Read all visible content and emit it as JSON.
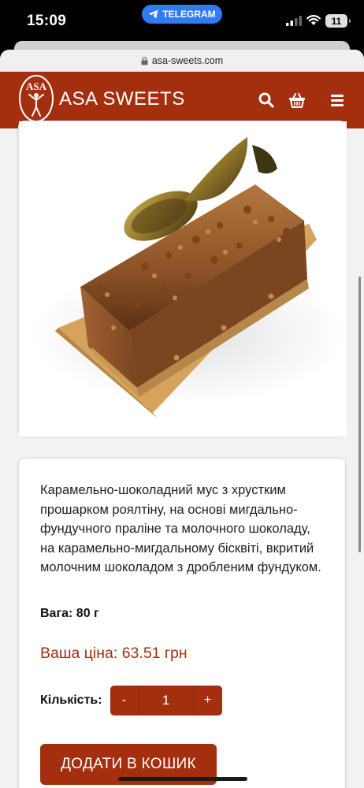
{
  "status_bar": {
    "time": "15:09",
    "app_pill": "TELEGRAM",
    "battery": "11"
  },
  "browser": {
    "url": "asa-sweets.com"
  },
  "header": {
    "logo_text": "ASA",
    "brand": "ASA SWEETS",
    "icons": [
      "search-icon",
      "basket-icon",
      "menu-icon"
    ],
    "color": "#a42f0f"
  },
  "product": {
    "description": "Карамельно-шоколадний мус з хрустким прошарком роялтіну, на основі мигдально-фундучного праліне та молочного шоколаду, на карамельно-мигдальному бісквіті, вкритий молочним шоколадом з дробленим фундуком.",
    "weight": "Вага: 80 г",
    "price": "Ваша ціна: 63.51 грн",
    "quantity_label": "Кількість:",
    "qty_minus": "-",
    "qty_value": "1",
    "qty_plus": "+",
    "add_button": "ДОДАТИ В КОШИК"
  }
}
